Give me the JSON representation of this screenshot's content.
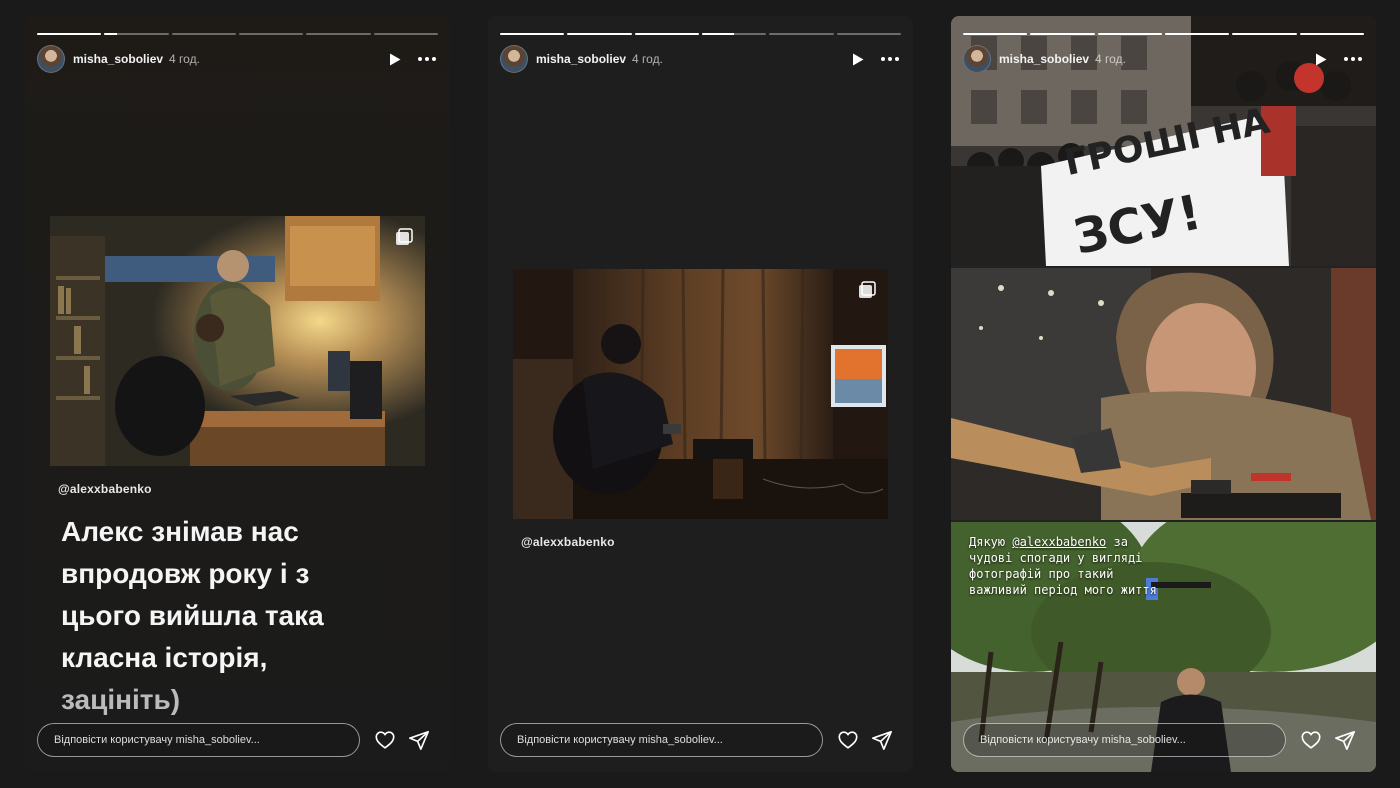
{
  "stories": [
    {
      "username": "misha_soboliev",
      "time": "4 год.",
      "mention": "@alexxbabenko",
      "caption_main": "Алекс знімав нас впродовж року і з цього вийшла така класна історія,",
      "caption_fade": "зацініть)",
      "reply_placeholder": "Відповісти користувачу misha_soboliev...",
      "progress": [
        1,
        0.2,
        0,
        0,
        0,
        0
      ]
    },
    {
      "username": "misha_soboliev",
      "time": "4 год.",
      "mention": "@alexxbabenko",
      "reply_placeholder": "Відповісти користувачу misha_soboliev...",
      "progress": [
        1,
        1,
        1,
        0.5,
        0,
        0
      ]
    },
    {
      "username": "misha_soboliev",
      "time": "4 год.",
      "banner_line1": "ГРОШІ НА",
      "banner_line2": "ЗСУ!",
      "thanks_prefix": "Дякую ",
      "thanks_tag": "@alexxbabenko",
      "thanks_rest": "за чудові спогади у вигляді фотографій про такий важливий період мого життя",
      "reply_placeholder": "Відповісти користувачу misha_soboliev...",
      "progress": [
        1,
        1,
        1,
        1,
        1,
        1
      ]
    }
  ],
  "icons": {
    "play": "play-icon",
    "more": "more-icon",
    "heart": "heart-icon",
    "send": "send-icon",
    "multi_photo": "multi-photo-icon"
  },
  "colors": {
    "background": "#1a1a1a",
    "story_bg": "#1e1e1e",
    "text": "#ffffff"
  }
}
